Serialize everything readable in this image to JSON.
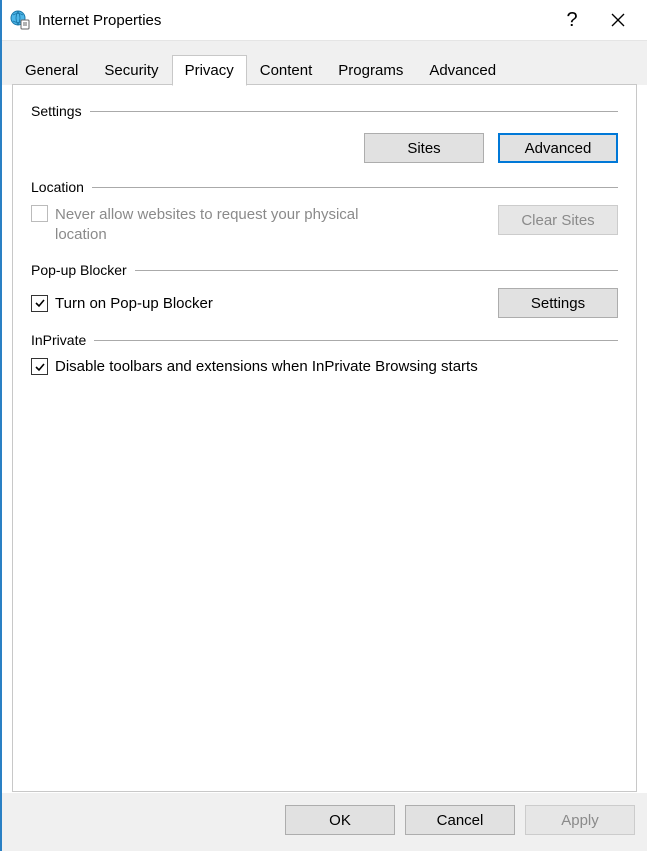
{
  "window": {
    "title": "Internet Properties",
    "help": "?",
    "close": "✕"
  },
  "tabs": {
    "general": "General",
    "security": "Security",
    "privacy": "Privacy",
    "content": "Content",
    "programs": "Programs",
    "advanced": "Advanced",
    "active": "privacy"
  },
  "sections": {
    "settings": {
      "label": "Settings",
      "sites_btn": "Sites",
      "advanced_btn": "Advanced"
    },
    "location": {
      "label": "Location",
      "checkbox_label": "Never allow websites to request your physical location",
      "checkbox_checked": false,
      "checkbox_enabled": false,
      "clear_sites_btn": "Clear Sites",
      "clear_sites_enabled": false
    },
    "popup": {
      "label": "Pop-up Blocker",
      "checkbox_label": "Turn on Pop-up Blocker",
      "checkbox_checked": true,
      "settings_btn": "Settings"
    },
    "inprivate": {
      "label": "InPrivate",
      "checkbox_label": "Disable toolbars and extensions when InPrivate Browsing starts",
      "checkbox_checked": true
    }
  },
  "footer": {
    "ok": "OK",
    "cancel": "Cancel",
    "apply": "Apply",
    "apply_enabled": false
  }
}
